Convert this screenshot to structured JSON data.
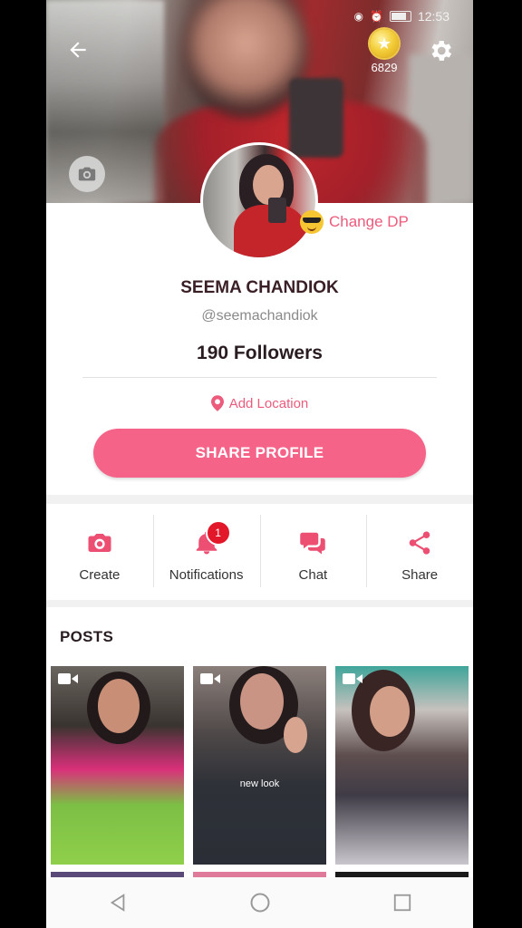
{
  "status_bar": {
    "time": "12:53"
  },
  "header": {
    "coin_count": "6829"
  },
  "profile": {
    "change_dp_label": "Change DP",
    "name": "SEEMA CHANDIOK",
    "handle": "@seemachandiok",
    "followers": "190 Followers",
    "location_label": "Add Location",
    "share_profile_label": "SHARE PROFILE"
  },
  "actions": [
    {
      "label": "Create",
      "icon": "camera-icon"
    },
    {
      "label": "Notifications",
      "icon": "bell-icon",
      "badge": "1"
    },
    {
      "label": "Chat",
      "icon": "chat-icon"
    },
    {
      "label": "Share",
      "icon": "share-icon"
    }
  ],
  "posts": {
    "title": "POSTS",
    "items": [
      {
        "caption": ""
      },
      {
        "caption": "new look"
      },
      {
        "caption": ""
      }
    ]
  },
  "colors": {
    "accent": "#f56389",
    "badge": "#e3172a",
    "text_pink": "#ec5b7c"
  }
}
